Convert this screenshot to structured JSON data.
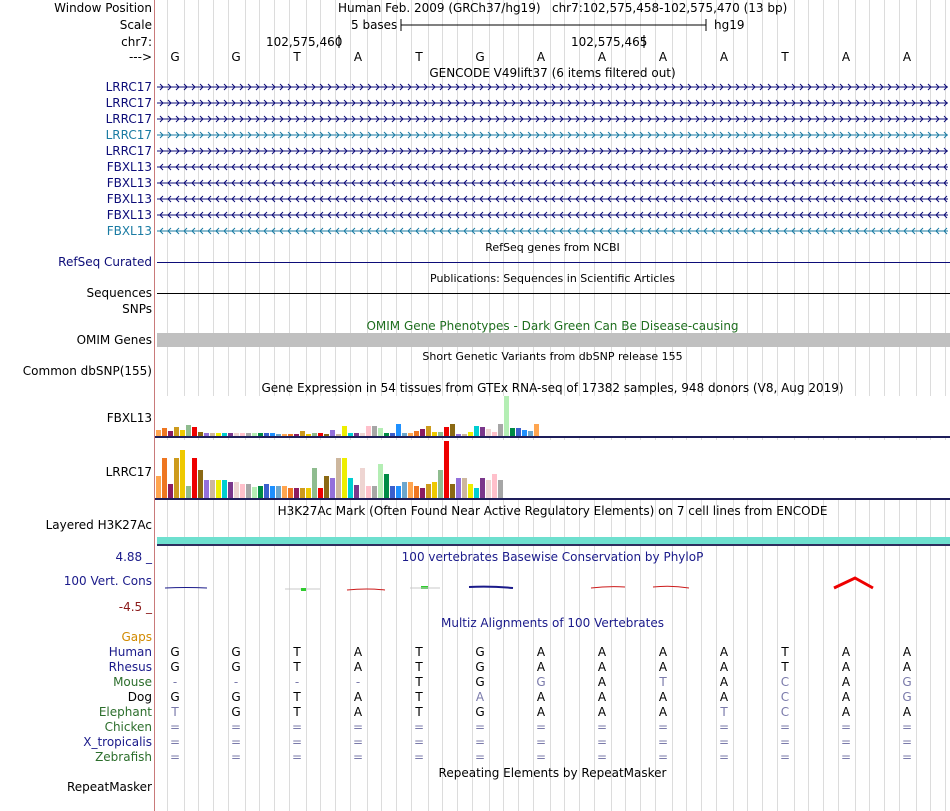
{
  "header": {
    "window_position_label": "Window Position",
    "scale_label": "Scale",
    "chrom_label": "chr7:",
    "strand_label": "--->",
    "assembly": "Human Feb. 2009 (GRCh37/hg19)",
    "position": "chr7:102,575,458-102,575,470 (13 bp)",
    "scale_text": "5 bases",
    "scale_db": "hg19",
    "coord1": "102,575,460",
    "coord2": "102,575,465"
  },
  "bases": [
    "G",
    "G",
    "T",
    "A",
    "T",
    "G",
    "A",
    "A",
    "A",
    "A",
    "T",
    "A",
    "A"
  ],
  "gencode": {
    "title": "GENCODE V49lift37 (6 items filtered out)",
    "items": [
      {
        "label": "LRRC17",
        "dir": "+",
        "color": "#0c0c78"
      },
      {
        "label": "LRRC17",
        "dir": "+",
        "color": "#0c0c78"
      },
      {
        "label": "LRRC17",
        "dir": "+",
        "color": "#0c0c78"
      },
      {
        "label": "LRRC17",
        "dir": "+",
        "color": "#1a7ba3"
      },
      {
        "label": "LRRC17",
        "dir": "+",
        "color": "#0c0c78"
      },
      {
        "label": "FBXL13",
        "dir": "-",
        "color": "#0c0c78"
      },
      {
        "label": "FBXL13",
        "dir": "-",
        "color": "#0c0c78"
      },
      {
        "label": "FBXL13",
        "dir": "-",
        "color": "#0c0c78"
      },
      {
        "label": "FBXL13",
        "dir": "-",
        "color": "#0c0c78"
      },
      {
        "label": "FBXL13",
        "dir": "-",
        "color": "#1a7ba3"
      }
    ]
  },
  "refseq": {
    "title": "RefSeq genes from NCBI",
    "label": "RefSeq Curated",
    "color": "#0c0c78"
  },
  "publications": {
    "title": "Publications: Sequences in Scientific Articles",
    "label": "Sequences"
  },
  "snps": {
    "label": "SNPs"
  },
  "omim": {
    "title": "OMIM Gene Phenotypes - Dark Green Can Be Disease-causing",
    "label": "OMIM Genes",
    "color": "#1e6e1e"
  },
  "dbsnp": {
    "title": "Short Genetic Variants from dbSNP release 155",
    "label": "Common dbSNP(155)"
  },
  "gtex": {
    "title": "Gene Expression in 54 tissues from GTEx RNA-seq of 17382 samples, 948 donors (V8, Aug 2019)",
    "label1": "FBXL13",
    "label2": "LRRC17",
    "colors": [
      "#FFA54F",
      "#EE7621",
      "#8B1C62",
      "#CD9B1D",
      "#EEC900",
      "#8FBC8F",
      "#EE0000",
      "#8B6914",
      "#9370DB",
      "#CDB79E",
      "#EEEE00",
      "#00CED1",
      "#7A378B",
      "#EED5D2",
      "#FFC0CB",
      "#A6A6A6",
      "#B4EEB4",
      "#008B45",
      "#3A5FCD",
      "#1E90FF",
      "#6CA6CD"
    ],
    "fbxl13": [
      6,
      8,
      5,
      9,
      6,
      11,
      9,
      4,
      3,
      3,
      3,
      3,
      3,
      3,
      3,
      3,
      3,
      3,
      3,
      3,
      2,
      2,
      2,
      2,
      5,
      2,
      3,
      3,
      2,
      6,
      2,
      10,
      3,
      3,
      3,
      10,
      10,
      8,
      3,
      3,
      12,
      3,
      3,
      5,
      7,
      10,
      4,
      4,
      9,
      12,
      2,
      2,
      4,
      10,
      9,
      7,
      4,
      12,
      40,
      8,
      8,
      6,
      5,
      12
    ],
    "lrrc17": [
      22,
      40,
      14,
      40,
      48,
      12,
      40,
      28,
      18,
      18,
      18,
      18,
      16,
      16,
      14,
      14,
      11,
      12,
      14,
      12,
      12,
      12,
      10,
      10,
      10,
      10,
      30,
      10,
      22,
      20,
      40,
      40,
      20,
      13,
      30,
      12,
      12,
      34,
      24,
      12,
      12,
      16,
      16,
      12,
      10,
      14,
      16,
      28,
      57,
      14,
      20,
      20,
      14,
      10,
      20,
      18,
      24,
      18
    ]
  },
  "h3k27ac": {
    "title": "H3K27Ac Mark (Often Found Near Active Regulatory Elements) on 7 cell lines from ENCODE",
    "label": "Layered H3K27Ac"
  },
  "cons": {
    "title": "100 vertebrates Basewise Conservation by PhyloP",
    "label": "100 Vert. Cons",
    "max": "4.88 _",
    "min": "-4.5 _"
  },
  "multiz": {
    "title": "Multiz Alignments of 100 Vertebrates",
    "gaps_label": "Gaps",
    "species": [
      {
        "name": "Human",
        "bases": [
          "G",
          "G",
          "T",
          "A",
          "T",
          "G",
          "A",
          "A",
          "A",
          "A",
          "T",
          "A",
          "A"
        ]
      },
      {
        "name": "Rhesus",
        "bases": [
          "G",
          "G",
          "T",
          "A",
          "T",
          "G",
          "A",
          "A",
          "A",
          "A",
          "T",
          "A",
          "A"
        ]
      },
      {
        "name": "Mouse",
        "bases": [
          "-",
          "-",
          "-",
          "-",
          "T",
          "G",
          "G",
          "A",
          "T",
          "A",
          "C",
          "A",
          "G"
        ]
      },
      {
        "name": "Dog",
        "bases": [
          "G",
          "G",
          "T",
          "A",
          "T",
          "A",
          "A",
          "A",
          "A",
          "A",
          "C",
          "A",
          "G"
        ]
      },
      {
        "name": "Elephant",
        "bases": [
          "T",
          "G",
          "T",
          "A",
          "T",
          "G",
          "A",
          "A",
          "A",
          "T",
          "C",
          "A",
          "A"
        ]
      },
      {
        "name": "Chicken",
        "bases": [
          "=",
          "=",
          "=",
          "=",
          "=",
          "=",
          "=",
          "=",
          "=",
          "=",
          "=",
          "=",
          "="
        ]
      },
      {
        "name": "X_tropicalis",
        "bases": [
          "=",
          "=",
          "=",
          "=",
          "=",
          "=",
          "=",
          "=",
          "=",
          "=",
          "=",
          "=",
          "="
        ]
      },
      {
        "name": "Zebrafish",
        "bases": [
          "=",
          "=",
          "=",
          "=",
          "=",
          "=",
          "=",
          "=",
          "=",
          "=",
          "=",
          "=",
          "="
        ]
      }
    ]
  },
  "repeatmasker": {
    "title": "Repeating Elements by RepeatMasker",
    "label": "RepeatMasker"
  }
}
